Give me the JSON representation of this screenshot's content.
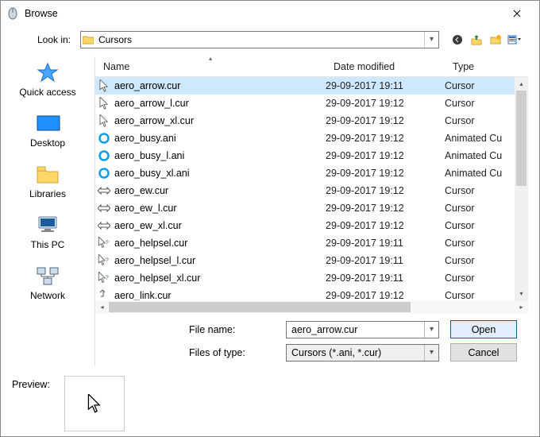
{
  "window": {
    "title": "Browse"
  },
  "toolbar": {
    "look_in_label": "Look in:",
    "look_in_value": "Cursors"
  },
  "places": [
    {
      "key": "quick",
      "label": "Quick access"
    },
    {
      "key": "desktop",
      "label": "Desktop"
    },
    {
      "key": "libraries",
      "label": "Libraries"
    },
    {
      "key": "thispc",
      "label": "This PC"
    },
    {
      "key": "network",
      "label": "Network"
    }
  ],
  "columns": {
    "name": "Name",
    "date": "Date modified",
    "type": "Type"
  },
  "files": [
    {
      "icon": "arrow",
      "name": "aero_arrow.cur",
      "date": "29-09-2017 19:11",
      "type": "Cursor",
      "selected": true
    },
    {
      "icon": "arrow",
      "name": "aero_arrow_l.cur",
      "date": "29-09-2017 19:12",
      "type": "Cursor"
    },
    {
      "icon": "arrow",
      "name": "aero_arrow_xl.cur",
      "date": "29-09-2017 19:12",
      "type": "Cursor"
    },
    {
      "icon": "busy",
      "name": "aero_busy.ani",
      "date": "29-09-2017 19:12",
      "type": "Animated Cu"
    },
    {
      "icon": "busy",
      "name": "aero_busy_l.ani",
      "date": "29-09-2017 19:12",
      "type": "Animated Cu"
    },
    {
      "icon": "busy",
      "name": "aero_busy_xl.ani",
      "date": "29-09-2017 19:12",
      "type": "Animated Cu"
    },
    {
      "icon": "ew",
      "name": "aero_ew.cur",
      "date": "29-09-2017 19:12",
      "type": "Cursor"
    },
    {
      "icon": "ew",
      "name": "aero_ew_l.cur",
      "date": "29-09-2017 19:12",
      "type": "Cursor"
    },
    {
      "icon": "ew",
      "name": "aero_ew_xl.cur",
      "date": "29-09-2017 19:12",
      "type": "Cursor"
    },
    {
      "icon": "help",
      "name": "aero_helpsel.cur",
      "date": "29-09-2017 19:11",
      "type": "Cursor"
    },
    {
      "icon": "help",
      "name": "aero_helpsel_l.cur",
      "date": "29-09-2017 19:11",
      "type": "Cursor"
    },
    {
      "icon": "help",
      "name": "aero_helpsel_xl.cur",
      "date": "29-09-2017 19:11",
      "type": "Cursor"
    },
    {
      "icon": "link",
      "name": "aero_link.cur",
      "date": "29-09-2017 19:12",
      "type": "Cursor"
    }
  ],
  "form": {
    "file_name_label": "File name:",
    "file_name_value": "aero_arrow.cur",
    "files_of_type_label": "Files of type:",
    "files_of_type_value": "Cursors (*.ani, *.cur)",
    "open_label": "Open",
    "cancel_label": "Cancel"
  },
  "preview": {
    "label": "Preview:"
  }
}
